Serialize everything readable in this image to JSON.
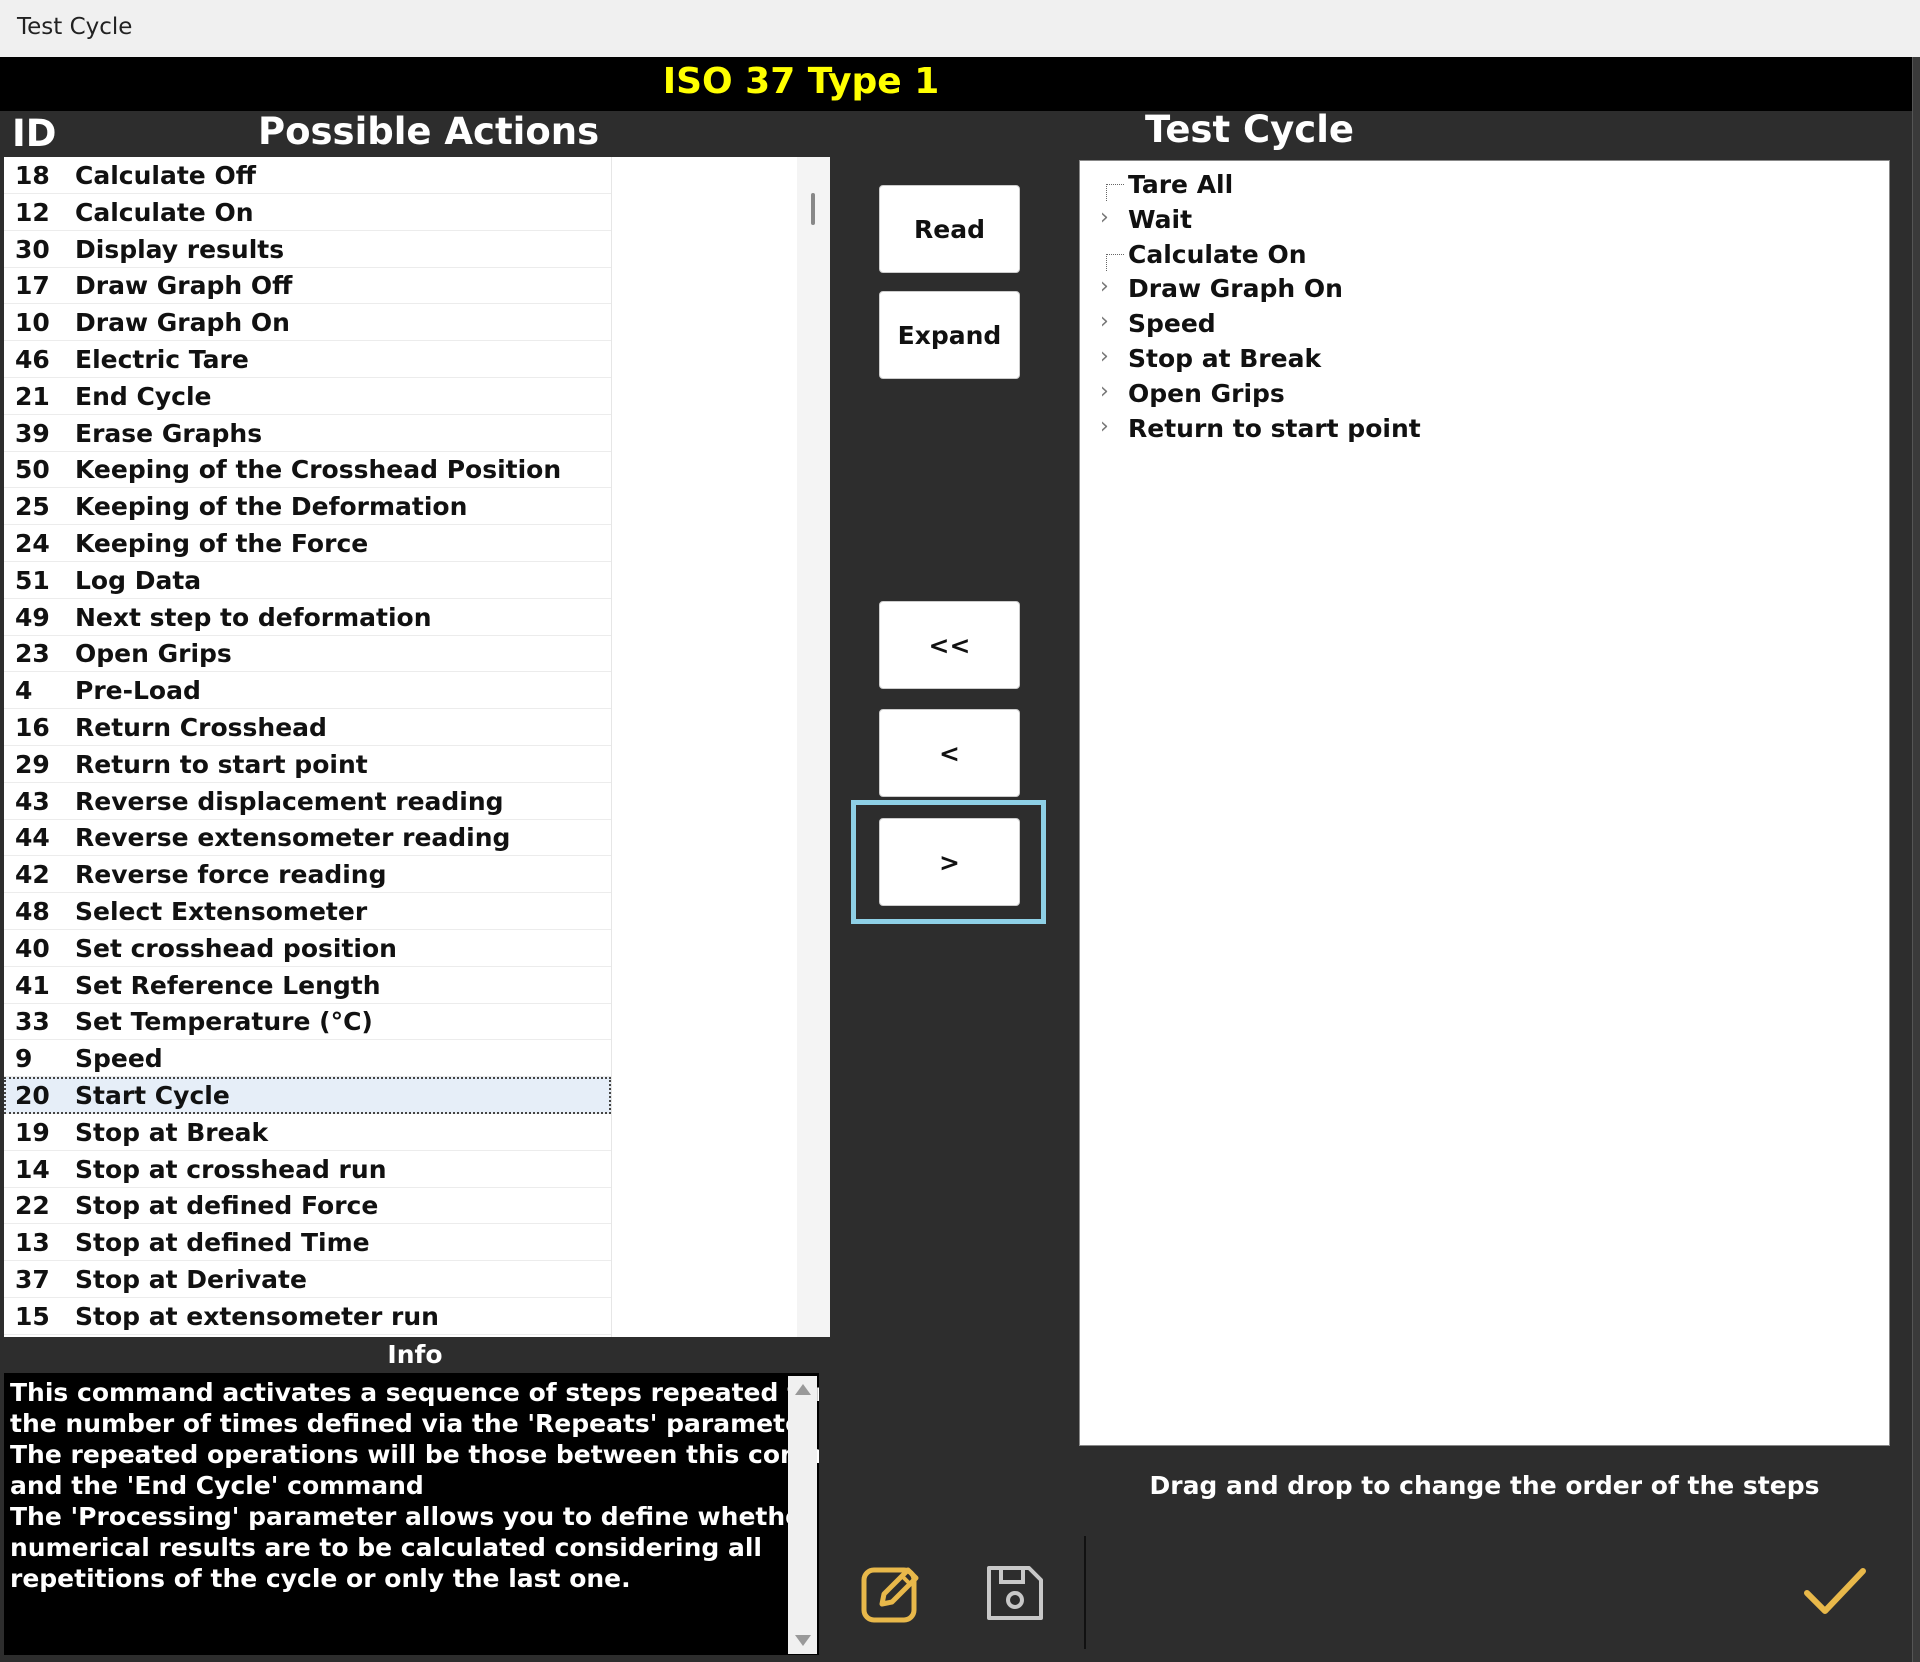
{
  "window": {
    "title": "Test Cycle"
  },
  "header": {
    "title": "ISO 37 Type 1"
  },
  "actions": {
    "id_header": "ID",
    "title": "Possible Actions",
    "selected_id": "20",
    "items": [
      {
        "id": "18",
        "name": "Calculate Off"
      },
      {
        "id": "12",
        "name": "Calculate On"
      },
      {
        "id": "30",
        "name": "Display results"
      },
      {
        "id": "17",
        "name": "Draw Graph Off"
      },
      {
        "id": "10",
        "name": "Draw Graph On"
      },
      {
        "id": "46",
        "name": "Electric Tare"
      },
      {
        "id": "21",
        "name": "End Cycle"
      },
      {
        "id": "39",
        "name": "Erase Graphs"
      },
      {
        "id": "50",
        "name": "Keeping of the Crosshead Position"
      },
      {
        "id": "25",
        "name": "Keeping of the Deformation"
      },
      {
        "id": "24",
        "name": "Keeping of the Force"
      },
      {
        "id": "51",
        "name": "Log Data"
      },
      {
        "id": "49",
        "name": "Next step to deformation"
      },
      {
        "id": "23",
        "name": "Open Grips"
      },
      {
        "id": "4",
        "name": "Pre-Load"
      },
      {
        "id": "16",
        "name": "Return Crosshead"
      },
      {
        "id": "29",
        "name": "Return to start point"
      },
      {
        "id": "43",
        "name": "Reverse displacement reading"
      },
      {
        "id": "44",
        "name": "Reverse extensometer reading"
      },
      {
        "id": "42",
        "name": "Reverse force reading"
      },
      {
        "id": "48",
        "name": "Select Extensometer"
      },
      {
        "id": "40",
        "name": "Set crosshead position"
      },
      {
        "id": "41",
        "name": "Set Reference Length"
      },
      {
        "id": "33",
        "name": "Set Temperature (°C)"
      },
      {
        "id": "9",
        "name": "Speed"
      },
      {
        "id": "20",
        "name": "Start Cycle"
      },
      {
        "id": "19",
        "name": "Stop at Break"
      },
      {
        "id": "14",
        "name": "Stop at crosshead run"
      },
      {
        "id": "22",
        "name": "Stop at defined Force"
      },
      {
        "id": "13",
        "name": "Stop at defined Time"
      },
      {
        "id": "37",
        "name": "Stop at Derivate"
      },
      {
        "id": "15",
        "name": "Stop at extensometer run"
      }
    ]
  },
  "info": {
    "label": "Info",
    "lines": [
      "This command activates a sequence of steps repeated for",
      "the number of times defined via the 'Repeats' parameter",
      "The repeated operations will be those between this command",
      "and the 'End Cycle' command",
      "The 'Processing' parameter allows you to define whether the",
      "numerical results are to be calculated considering all",
      "repetitions of the cycle or only the last one."
    ]
  },
  "buttons": {
    "read": "Read",
    "expand": "Expand",
    "remove_all": "<<",
    "remove": "<",
    "add": ">"
  },
  "test_cycle": {
    "title": "Test Cycle",
    "steps": [
      {
        "label": "Tare All",
        "expandable": false
      },
      {
        "label": "Wait",
        "expandable": true
      },
      {
        "label": "Calculate On",
        "expandable": false
      },
      {
        "label": "Draw Graph On",
        "expandable": true
      },
      {
        "label": "Speed",
        "expandable": true
      },
      {
        "label": "Stop at Break",
        "expandable": true
      },
      {
        "label": "Open Grips",
        "expandable": true
      },
      {
        "label": "Return to start point",
        "expandable": true
      }
    ],
    "hint": "Drag and drop to change the order of the steps"
  },
  "footer": {
    "edit_icon": "edit-icon",
    "save_icon": "save-icon",
    "confirm_icon": "checkmark-icon"
  },
  "colors": {
    "accent_yellow": "#ffff00",
    "icon_gold": "#e8b84a",
    "focus_frame": "#8ed0e6"
  }
}
